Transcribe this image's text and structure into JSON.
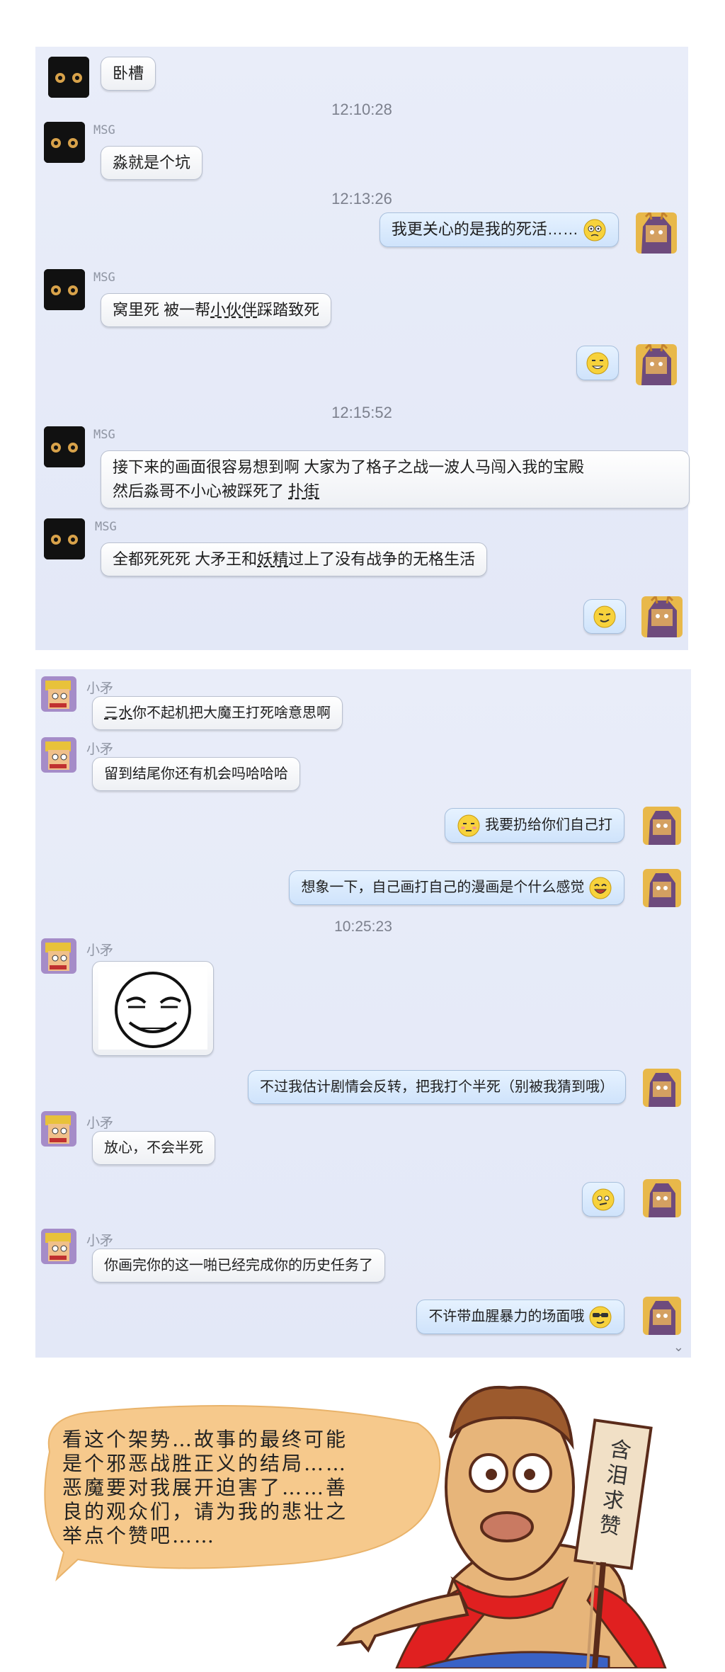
{
  "colors": {
    "panel_bg": "#e6ebf8",
    "bubble_left": "#ffffff",
    "bubble_right": "#d9eafd",
    "timestamp": "#7c808d",
    "speech_bubble": "#f6c98c",
    "cape": "#e02020"
  },
  "chat1": {
    "messages": [
      {
        "text": "卧槽"
      },
      {
        "timestamp": "12:10:28"
      },
      {
        "sender": "MSG",
        "text": "淼就是个坑"
      },
      {
        "timestamp": "12:13:26"
      },
      {
        "text": "我更关心的是我的死活……",
        "emoji": "confused-face-icon"
      },
      {
        "sender": "MSG",
        "text_a": "窝里死  被一帮",
        "text_u": "小伙伴",
        "text_b": "踩踏致死"
      },
      {
        "emoji": "grin-face-icon"
      },
      {
        "timestamp": "12:15:52"
      },
      {
        "sender": "MSG",
        "line1": "接下来的画面很容易想到啊 大家为了格子之战一波人马闯入我的宝殿",
        "line2_a": "然后淼哥不小心被踩死了  ",
        "line2_u": "扑街"
      },
      {
        "sender": "MSG",
        "text_a": "全都死死死     大矛王和",
        "text_u": "妖精",
        "text_b": "过上了没有战争的无格生活"
      },
      {
        "emoji": "smirk-face-icon"
      }
    ]
  },
  "chat2": {
    "messages": [
      {
        "sender": "小矛",
        "text_u": "三水",
        "text_b": "你不起机把大魔王打死啥意思啊"
      },
      {
        "sender": "小矛",
        "text": "留到结尾你还有机会吗哈哈哈"
      },
      {
        "text": "我要扔给你们自己打",
        "emoji": "shy-face-icon"
      },
      {
        "text": "想象一下，自己画打自己的漫画是个什么感觉",
        "emoji": "laugh-face-icon"
      },
      {
        "timestamp": "10:25:23"
      },
      {
        "sender": "小矛",
        "sticker": "smug-meme-face"
      },
      {
        "text": "不过我估计剧情会反转，把我打个半死（别被我猜到哦）"
      },
      {
        "sender": "小矛",
        "text": "放心，不会半死"
      },
      {
        "emoji": "smug-face-icon"
      },
      {
        "sender": "小矛",
        "text": "你画完你的这一啪已经完成你的历史任务了"
      },
      {
        "text": "不许带血腥暴力的场面哦",
        "emoji": "cool-face-icon"
      }
    ],
    "scroll_icon": "chevron-down-icon"
  },
  "comic": {
    "speech_lines": [
      "看这个架势…故事的最终可能",
      "是个邪恶战胜正义的结局……",
      "恶魔要对我展开迫害了……善",
      "良的观众们，请为我的悲壮之",
      "举点个赞吧……"
    ],
    "sign_text": "含泪求赞"
  }
}
